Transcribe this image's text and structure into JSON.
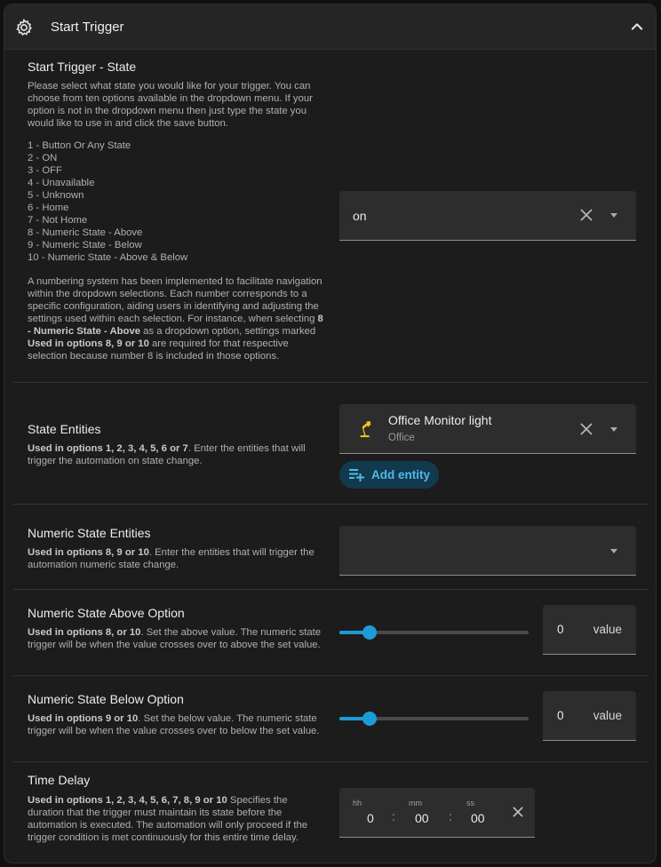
{
  "header": {
    "title": "Start Trigger",
    "icon": "gear-icon",
    "collapse_icon": "chevron-up-icon"
  },
  "start_state": {
    "title": "Start Trigger - State",
    "intro": "Please select what state you would like for your trigger. You can choose from ten options available in the dropdown menu. If your option is not in the dropdown menu then just type the state you would like to use in and click the save button.",
    "options": [
      "1 - Button Or Any State",
      "2 - ON",
      "3 - OFF",
      "4 - Unavailable",
      "5 - Unknown",
      "6 - Home",
      "7 - Not Home",
      "8 - Numeric State - Above",
      "9 - Numeric State - Below",
      "10 - Numeric State - Above & Below"
    ],
    "note_part1": "A numbering system has been implemented to facilitate navigation within the dropdown selections. Each number corresponds to a specific configuration, aiding users in identifying and adjusting the settings used within each selection. For instance, when selecting ",
    "note_bold1": "8 - Numeric State - Above",
    "note_part2": " as a dropdown option, settings marked ",
    "note_bold2": "Used in options 8, 9 or 10",
    "note_part3": " are required for that respective selection because number 8 is included in those options.",
    "value": "on"
  },
  "state_entities": {
    "title": "State Entities",
    "desc_bold": "Used in options 1, 2, 3, 4, 5, 6 or 7",
    "desc": ". Enter the entities that will trigger the automation on state change.",
    "entity_name": "Office Monitor light",
    "entity_area": "Office",
    "entity_icon": "desk-lamp-icon",
    "add_label": "Add entity"
  },
  "numeric_entities": {
    "title": "Numeric State Entities",
    "desc_bold": "Used in options 8, 9 or 10",
    "desc": ". Enter the entities that will trigger the automation numeric state change.",
    "value": ""
  },
  "above": {
    "title": "Numeric State Above Option",
    "desc_bold": "Used in options 8, or 10",
    "desc": ". Set the above value. The numeric state trigger will be when the value crosses over to above the set value.",
    "value": "0",
    "unit": "value",
    "slider_fraction": 0.16
  },
  "below": {
    "title": "Numeric State Below Option",
    "desc_bold": "Used in options 9 or 10",
    "desc": ". Set the below value. The numeric state trigger will be when the value crosses over to below the set value.",
    "value": "0",
    "unit": "value",
    "slider_fraction": 0.16
  },
  "time_delay": {
    "title": "Time Delay",
    "desc_bold": "Used in options 1, 2, 3, 4, 5, 6, 7, 8, 9 or 10",
    "desc": " Specifies the duration that the trigger must maintain its state before the automation is executed. The automation will only proceed if the trigger condition is met continuously for this entire time delay.",
    "hh_label": "hh",
    "mm_label": "mm",
    "ss_label": "ss",
    "hh": "0",
    "mm": "00",
    "ss": "00"
  },
  "colors": {
    "accent": "#1d9bd6",
    "add_button_bg": "#113a4e",
    "add_button_text": "#53b8e8",
    "lamp_icon": "#f5c518"
  }
}
